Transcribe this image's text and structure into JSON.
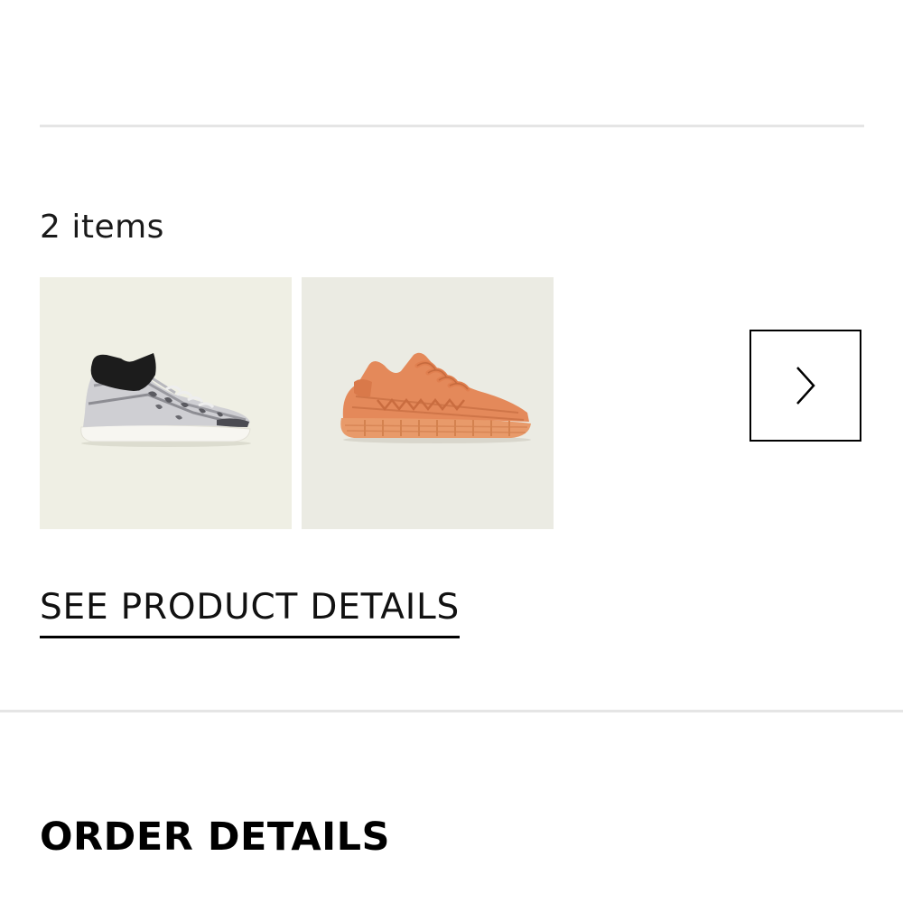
{
  "colors": {
    "tile_background_1": "#efefe4",
    "tile_background_2": "#ebebe3",
    "divider": "#e5e5e5",
    "text": "#000000"
  },
  "order_items": {
    "count_label": "2 items",
    "products": [
      {
        "image": "white-black-knit-sneaker-image"
      },
      {
        "image": "orange-knit-sneaker-image"
      }
    ],
    "next_icon": "chevron-right-icon"
  },
  "product_details_link": "SEE PRODUCT DETAILS",
  "order_details": {
    "title": "ORDER DETAILS"
  }
}
